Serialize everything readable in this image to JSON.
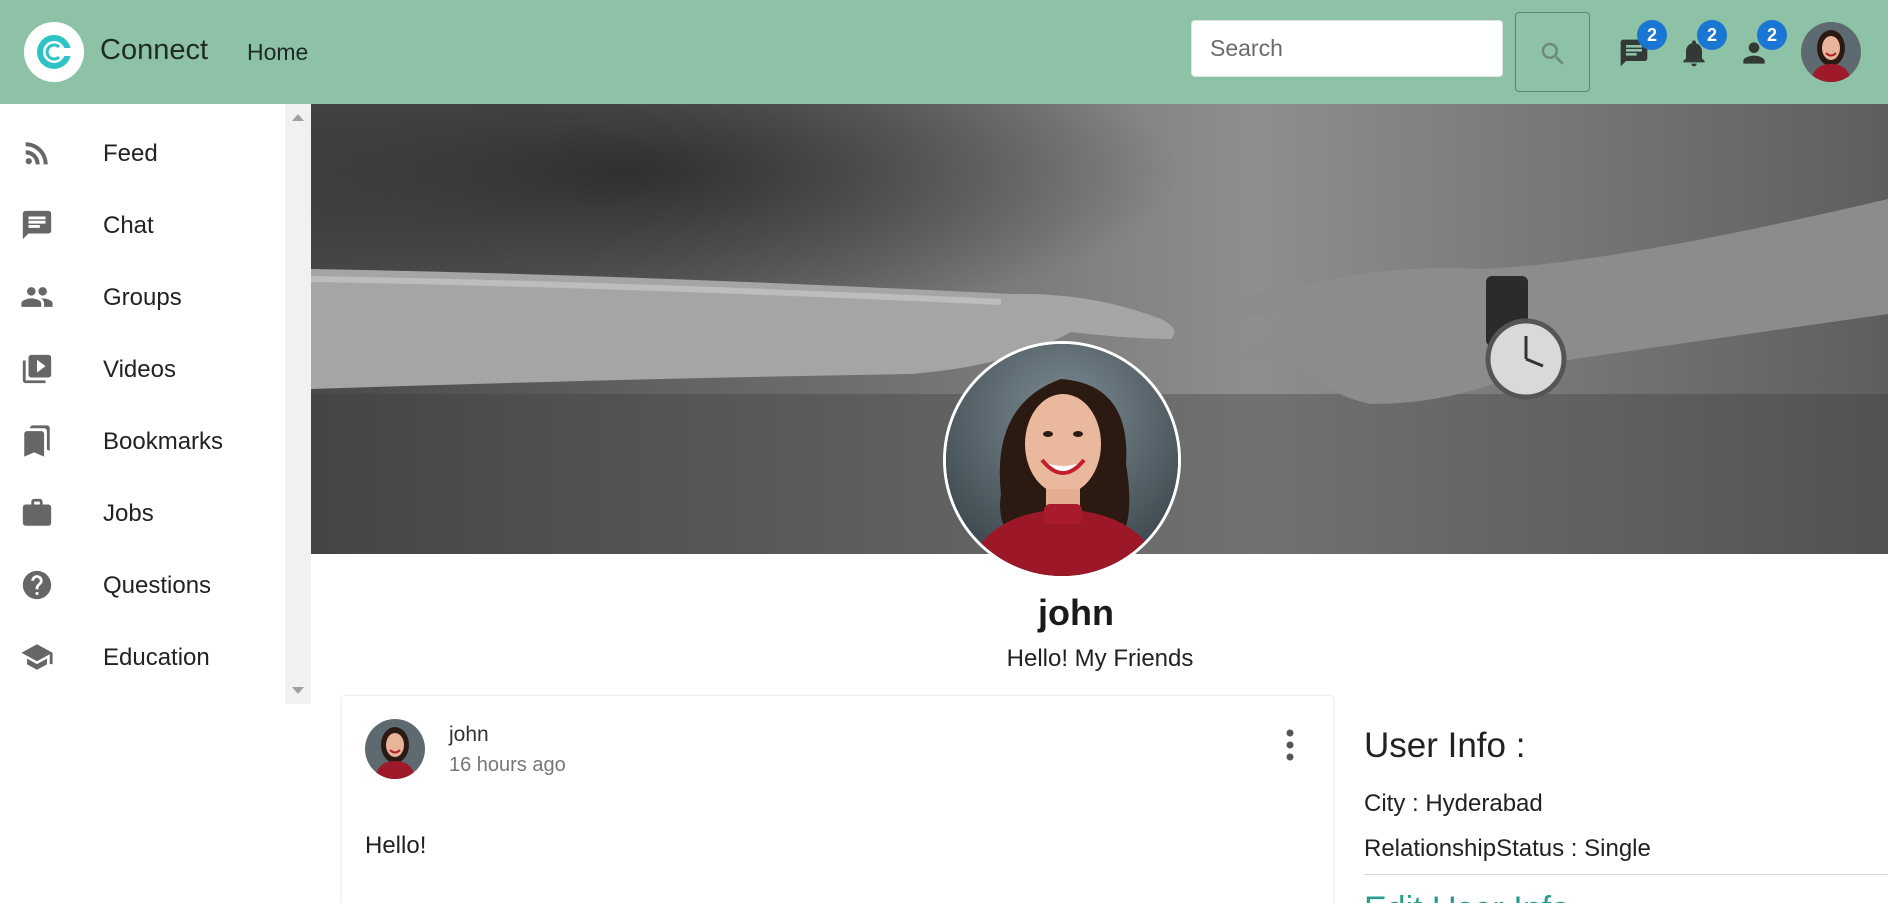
{
  "app": {
    "name": "Connect",
    "nav_home": "Home"
  },
  "search": {
    "placeholder": "Search"
  },
  "badges": {
    "messages": "2",
    "notifications": "2",
    "friends": "2"
  },
  "sidebar": {
    "items": [
      {
        "label": "Feed",
        "icon": "rss-feed-icon"
      },
      {
        "label": "Chat",
        "icon": "chat-icon"
      },
      {
        "label": "Groups",
        "icon": "groups-icon"
      },
      {
        "label": "Videos",
        "icon": "video-library-icon"
      },
      {
        "label": "Bookmarks",
        "icon": "bookmarks-icon"
      },
      {
        "label": "Jobs",
        "icon": "work-icon"
      },
      {
        "label": "Questions",
        "icon": "help-icon"
      },
      {
        "label": "Education",
        "icon": "school-icon"
      }
    ]
  },
  "profile": {
    "name": "john",
    "bio": "Hello! My Friends"
  },
  "post": {
    "author": "john",
    "time": "16 hours ago",
    "text": "Hello!"
  },
  "user_info": {
    "title": "User Info :",
    "city": "City : Hyderabad",
    "relationship": "RelationshipStatus : Single",
    "link": "Edit User Info"
  },
  "colors": {
    "topbar": "#8dc2a6",
    "badge": "#1976d2",
    "logo_accent": "#2ec4c6",
    "link": "#2a9d8f"
  }
}
